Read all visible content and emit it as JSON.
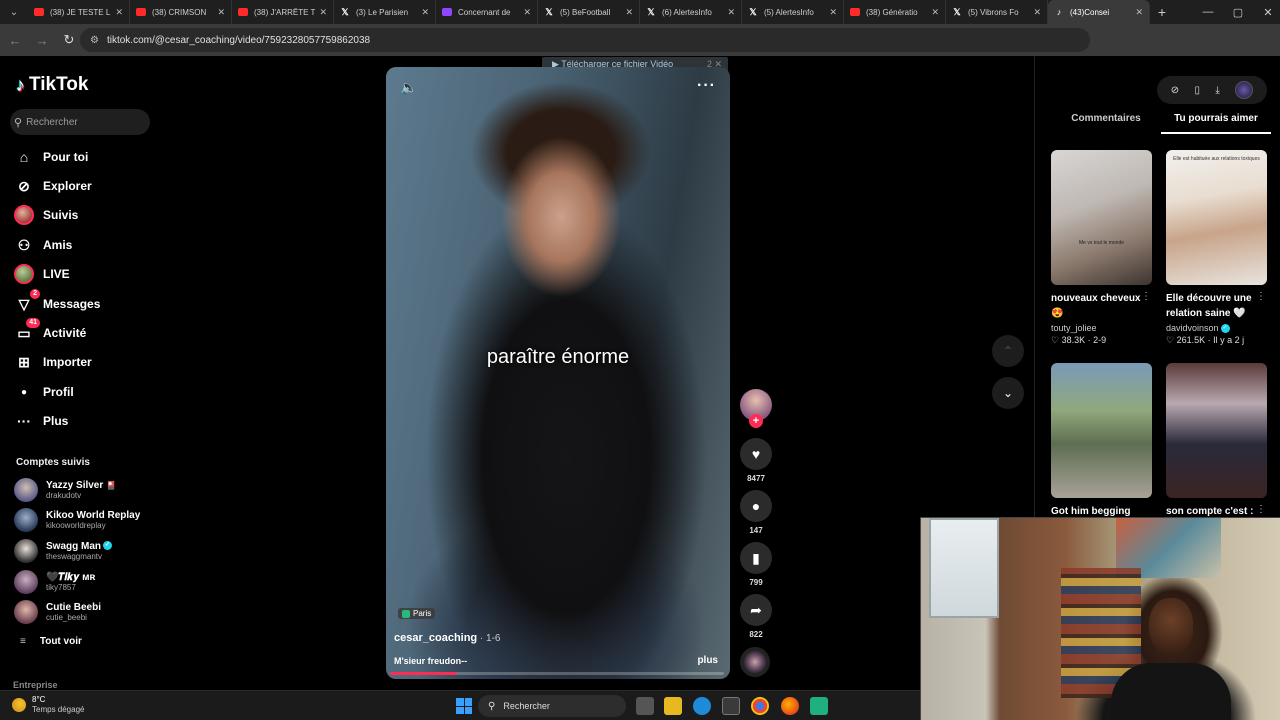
{
  "browser": {
    "tabs": [
      {
        "title": "(38) JE TESTE L",
        "favicon": "youtube-icon"
      },
      {
        "title": "(38) CRIMSON",
        "favicon": "youtube-icon"
      },
      {
        "title": "(38) J'ARRÊTE T",
        "favicon": "youtube-icon"
      },
      {
        "title": "(3) Le Parisien",
        "favicon": "x-icon"
      },
      {
        "title": "Concernant de",
        "favicon": "twitch-icon"
      },
      {
        "title": "(5) BeFootball",
        "favicon": "x-icon"
      },
      {
        "title": "(6) AlertesInfo",
        "favicon": "x-icon"
      },
      {
        "title": "(5) AlertesInfo",
        "favicon": "x-icon"
      },
      {
        "title": "(38) Génératio",
        "favicon": "youtube-icon"
      },
      {
        "title": "(5) Vibrons Fo",
        "favicon": "x-icon"
      },
      {
        "title": "(43)Consei",
        "favicon": "tiktok-icon",
        "active": true
      }
    ],
    "url": "tiktok.com/@cesar_coaching/video/7592328057759862038"
  },
  "sidebar": {
    "brand": "TikTok",
    "search_placeholder": "Rechercher",
    "nav": [
      {
        "label": "Pour toi",
        "icon": "home-icon"
      },
      {
        "label": "Explorer",
        "icon": "compass-icon"
      },
      {
        "label": "Suivis",
        "icon": "avatar"
      },
      {
        "label": "Amis",
        "icon": "friends-icon"
      },
      {
        "label": "LIVE",
        "icon": "avatar"
      },
      {
        "label": "Messages",
        "icon": "send-icon",
        "badge": "2"
      },
      {
        "label": "Activité",
        "icon": "inbox-icon",
        "badge": "41"
      },
      {
        "label": "Importer",
        "icon": "plus-square-icon"
      },
      {
        "label": "Profil",
        "icon": "person-icon"
      },
      {
        "label": "Plus",
        "icon": "more-icon"
      }
    ],
    "followed_title": "Comptes suivis",
    "followed": [
      {
        "name": "Yazzy Silver",
        "handle": "drakudotv",
        "badge": "🎴"
      },
      {
        "name": "Kikoo World Replay",
        "handle": "kikooworldreplay"
      },
      {
        "name": "Swagg Man",
        "handle": "theswaggmantv",
        "verified": true
      },
      {
        "name": "🖤𝑻𝒊𝒌𝒚 ᴍʀ",
        "handle": "tiky7857"
      },
      {
        "name": "Cutie Beebi",
        "handle": "cutie_beebi"
      }
    ],
    "see_all": "Tout voir",
    "footer": "Entreprise"
  },
  "video": {
    "download_bar": "▶ Télécharger ce fichier Vidéo",
    "download_count": "2",
    "caption": "paraître énorme",
    "location": "Paris",
    "author": "cesar_coaching",
    "date": " · 1-6",
    "description": "M'sieur freudon--",
    "more": "plus",
    "progress": 0.2
  },
  "actions": {
    "likes": "8477",
    "comments": "147",
    "saves": "799",
    "shares": "822"
  },
  "right_panel": {
    "tabs": [
      "Commentaires",
      "Tu pourrais aimer"
    ],
    "active_tab": 1,
    "cards": [
      {
        "title": "nouveaux cheveux 😍",
        "author": "touty_joliee",
        "stats": "♡ 38.3K · 2-9",
        "overlay": "Me vs tout le monde"
      },
      {
        "title": "Elle découvre une relation saine 🤍",
        "author": "davidvoinson",
        "stats": "♡ 261.5K · Il y a 2 j",
        "overlay": "Elle est habituée aux relations toxiques",
        "verified": true
      },
      {
        "title": "Got him begging",
        "author": "",
        "stats": "",
        "overlay": ""
      },
      {
        "title": "son compte c'est :",
        "author": "",
        "stats": "",
        "overlay": ""
      }
    ]
  },
  "taskbar": {
    "temp": "8°C",
    "weather": "Temps dégagé",
    "search_placeholder": "Rechercher"
  },
  "colors": {
    "accent": "#fe2c55",
    "verified": "#20d5ec",
    "background": "#000000"
  }
}
